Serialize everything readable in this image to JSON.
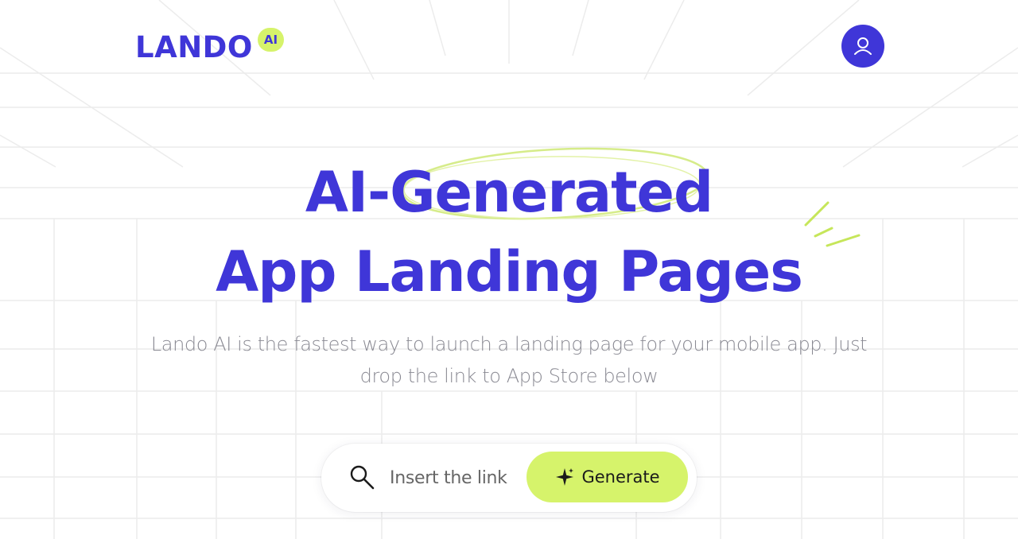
{
  "brand": {
    "name": "LANDO",
    "badge": "AI"
  },
  "header": {
    "account_icon": "user-icon"
  },
  "hero": {
    "title_line1": "AI-Generated",
    "title_line2": "App Landing Pages",
    "subtitle": "Lando AI is the fastest way to launch a landing page for your mobile app. Just drop the link to App Store below"
  },
  "search": {
    "icon": "search-icon",
    "placeholder": "Insert the link",
    "value": "",
    "button_icon": "sparkle-icon",
    "button_label": "Generate"
  },
  "colors": {
    "brand_primary": "#3f36d8",
    "accent_lime": "#d6f36b",
    "subtitle_gray": "#8a8a93"
  }
}
